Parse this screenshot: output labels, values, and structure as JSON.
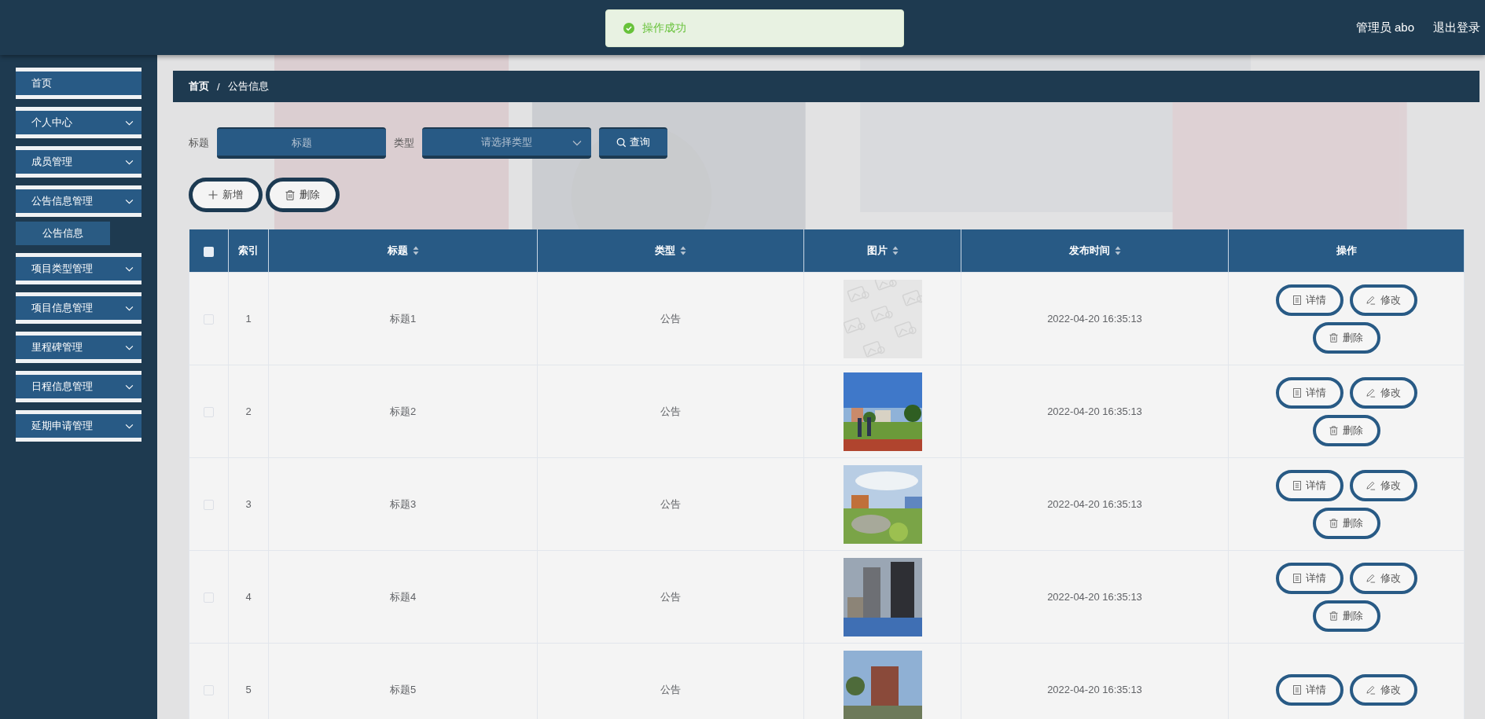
{
  "header": {
    "toast": {
      "message": "操作成功",
      "kind": "success"
    },
    "user": "管理员 abo",
    "logout": "退出登录"
  },
  "sidebar": {
    "items": [
      {
        "label": "首页",
        "kind": "link"
      },
      {
        "label": "个人中心",
        "kind": "menu"
      },
      {
        "label": "成员管理",
        "kind": "menu"
      },
      {
        "label": "公告信息管理",
        "kind": "menu",
        "children": [
          {
            "label": "公告信息",
            "selected": true
          }
        ]
      },
      {
        "label": "项目类型管理",
        "kind": "menu"
      },
      {
        "label": "项目信息管理",
        "kind": "menu"
      },
      {
        "label": "里程碑管理",
        "kind": "menu"
      },
      {
        "label": "日程信息管理",
        "kind": "menu"
      },
      {
        "label": "延期申请管理",
        "kind": "menu"
      }
    ]
  },
  "breadcrumb": {
    "separator": "/",
    "items": [
      "首页",
      "公告信息"
    ]
  },
  "search": {
    "fields": [
      {
        "label": "标题",
        "placeholder": "标题",
        "kind": "input"
      },
      {
        "label": "类型",
        "placeholder": "请选择类型",
        "kind": "select"
      }
    ],
    "button": "查询"
  },
  "actions": [
    {
      "label": "新增",
      "kind": "add"
    },
    {
      "label": "删除",
      "kind": "delete"
    }
  ],
  "table": {
    "select_all": false,
    "columns": [
      {
        "label": "索引",
        "sortable": false
      },
      {
        "label": "标题",
        "sortable": true
      },
      {
        "label": "类型",
        "sortable": true
      },
      {
        "label": "图片",
        "sortable": true
      },
      {
        "label": "发布时间",
        "sortable": true
      },
      {
        "label": "操作",
        "sortable": false
      }
    ],
    "rows": [
      {
        "checked": false,
        "index": "1",
        "title": "标题1",
        "type": "公告",
        "image": {
          "kind": "placeholder"
        },
        "time": "2022-04-20 16:35:13",
        "actions": [
          {
            "label": "详情",
            "kind": "detail"
          },
          {
            "label": "修改",
            "kind": "edit"
          },
          {
            "label": "删除",
            "kind": "delete"
          }
        ]
      },
      {
        "checked": false,
        "index": "2",
        "title": "标题2",
        "type": "公告",
        "image": {
          "kind": "picture"
        },
        "time": "2022-04-20 16:35:13",
        "actions": [
          {
            "label": "详情",
            "kind": "detail"
          },
          {
            "label": "修改",
            "kind": "edit"
          },
          {
            "label": "删除",
            "kind": "delete"
          }
        ]
      },
      {
        "checked": false,
        "index": "3",
        "title": "标题3",
        "type": "公告",
        "image": {
          "kind": "picture"
        },
        "time": "2022-04-20 16:35:13",
        "actions": [
          {
            "label": "详情",
            "kind": "detail"
          },
          {
            "label": "修改",
            "kind": "edit"
          },
          {
            "label": "删除",
            "kind": "delete"
          }
        ]
      },
      {
        "checked": false,
        "index": "4",
        "title": "标题4",
        "type": "公告",
        "image": {
          "kind": "picture"
        },
        "time": "2022-04-20 16:35:13",
        "actions": [
          {
            "label": "详情",
            "kind": "detail"
          },
          {
            "label": "修改",
            "kind": "edit"
          },
          {
            "label": "删除",
            "kind": "delete"
          }
        ]
      },
      {
        "checked": false,
        "index": "5",
        "title": "标题5",
        "type": "公告",
        "image": {
          "kind": "picture"
        },
        "time": "2022-04-20 16:35:13",
        "actions": [
          {
            "label": "详情",
            "kind": "detail"
          },
          {
            "label": "修改",
            "kind": "edit"
          }
        ]
      }
    ]
  }
}
